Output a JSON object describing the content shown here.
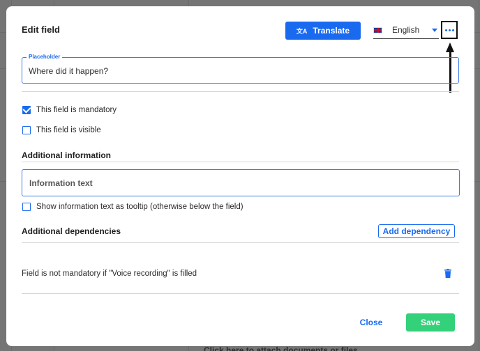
{
  "modal": {
    "title": "Edit field",
    "translate_label": "Translate",
    "translate_icon": "文A",
    "language": {
      "selected": "English",
      "flag": "gb-flag-icon"
    },
    "more_icon": "more-horizontal-icon"
  },
  "placeholder": {
    "legend": "Placeholder",
    "value": "Where did it happen?"
  },
  "options": [
    {
      "label": "This field is mandatory",
      "checked": true
    },
    {
      "label": "This field is visible",
      "checked": false
    }
  ],
  "additional_information": {
    "title": "Additional information",
    "input_placeholder": "Information text",
    "tooltip_option": {
      "label": "Show information text as tooltip (otherwise below the field)",
      "checked": false
    }
  },
  "additional_dependencies": {
    "title": "Additional dependencies",
    "add_label": "Add dependency",
    "items": [
      {
        "text": "Field is not mandatory if \"Voice recording\" is filled"
      }
    ]
  },
  "footer": {
    "close_label": "Close",
    "save_label": "Save"
  },
  "background": {
    "partial_text": "Click here to attach documents or files"
  },
  "colors": {
    "primary": "#1a6af0",
    "save": "#33d17a",
    "overlay": "#757575"
  }
}
